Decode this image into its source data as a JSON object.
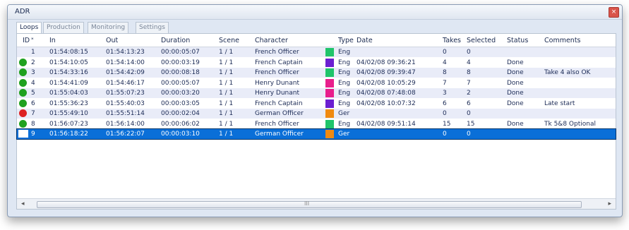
{
  "window": {
    "title": "ADR",
    "close_glyph": "×"
  },
  "tabs": [
    "Loops",
    "Production",
    "Monitoring",
    "Settings"
  ],
  "columns": [
    "ID",
    "In",
    "Out",
    "Duration",
    "Scene",
    "Character",
    "Type",
    "Date",
    "Takes",
    "Selected",
    "Status",
    "Comments"
  ],
  "sort_indicator": "*",
  "colors": {
    "status_green": "#1fa11f",
    "status_red": "#dd2222",
    "french_officer": "#1fc46a",
    "french_captain": "#6b1fd1",
    "henry_dunant": "#e81e8c",
    "german_officer": "#f08a10",
    "selected_row": "#0a6fd8"
  },
  "rows": [
    {
      "id": "1",
      "in": "01:54:08:15",
      "out": "01:54:13:23",
      "duration": "00:00:05:07",
      "scene": "1 / 1",
      "character": "French Officer",
      "type": "Eng",
      "date": "",
      "takes": "0",
      "selected": "0",
      "status": "",
      "comments": "",
      "dot": "none",
      "swatch": "french_officer",
      "shade": true
    },
    {
      "id": "2",
      "in": "01:54:10:05",
      "out": "01:54:14:00",
      "duration": "00:00:03:19",
      "scene": "1 / 1",
      "character": "French Captain",
      "type": "Eng",
      "date": "04/02/08 09:36:21",
      "takes": "4",
      "selected": "4",
      "status": "Done",
      "comments": "",
      "dot": "status_green",
      "swatch": "french_captain",
      "shade": false
    },
    {
      "id": "3",
      "in": "01:54:33:16",
      "out": "01:54:42:09",
      "duration": "00:00:08:18",
      "scene": "1 / 1",
      "character": "French Officer",
      "type": "Eng",
      "date": "04/02/08 09:39:47",
      "takes": "8",
      "selected": "8",
      "status": "Done",
      "comments": "Take 4 also OK",
      "dot": "status_green",
      "swatch": "french_officer",
      "shade": true
    },
    {
      "id": "4",
      "in": "01:54:41:09",
      "out": "01:54:46:17",
      "duration": "00:00:05:07",
      "scene": "1 / 1",
      "character": "Henry Dunant",
      "type": "Eng",
      "date": "04/02/08 10:05:29",
      "takes": "7",
      "selected": "7",
      "status": "Done",
      "comments": "",
      "dot": "status_green",
      "swatch": "henry_dunant",
      "shade": false
    },
    {
      "id": "5",
      "in": "01:55:04:03",
      "out": "01:55:07:23",
      "duration": "00:00:03:20",
      "scene": "1 / 1",
      "character": "Henry Dunant",
      "type": "Eng",
      "date": "04/02/08 07:48:08",
      "takes": "3",
      "selected": "2",
      "status": "Done",
      "comments": "",
      "dot": "status_green",
      "swatch": "henry_dunant",
      "shade": true
    },
    {
      "id": "6",
      "in": "01:55:36:23",
      "out": "01:55:40:03",
      "duration": "00:00:03:05",
      "scene": "1 / 1",
      "character": "French Captain",
      "type": "Eng",
      "date": "04/02/08 10:07:32",
      "takes": "6",
      "selected": "6",
      "status": "Done",
      "comments": "Late start",
      "dot": "status_green",
      "swatch": "french_captain",
      "shade": false
    },
    {
      "id": "7",
      "in": "01:55:49:10",
      "out": "01:55:51:14",
      "duration": "00:00:02:04",
      "scene": "1 / 1",
      "character": "German Officer",
      "type": "Ger",
      "date": "",
      "takes": "0",
      "selected": "0",
      "status": "",
      "comments": "",
      "dot": "status_red",
      "swatch": "german_officer",
      "shade": true
    },
    {
      "id": "8",
      "in": "01:56:07:23",
      "out": "01:56:14:00",
      "duration": "00:00:06:02",
      "scene": "1 / 1",
      "character": "French Officer",
      "type": "Eng",
      "date": "04/02/08 09:51:14",
      "takes": "15",
      "selected": "15",
      "status": "Done",
      "comments": "Tk 5&8 Optional",
      "dot": "status_green",
      "swatch": "french_officer",
      "shade": false
    },
    {
      "id": "9",
      "in": "01:56:18:22",
      "out": "01:56:22:07",
      "duration": "00:00:03:10",
      "scene": "1 / 1",
      "character": "German Officer",
      "type": "Ger",
      "date": "",
      "takes": "0",
      "selected": "0",
      "status": "",
      "comments": "",
      "dot": "white_box",
      "swatch": "german_officer",
      "shade": false,
      "selected_row": true
    }
  ],
  "scrollbar": {
    "left_arrow": "◂",
    "right_arrow": "▸",
    "grip": "III"
  }
}
